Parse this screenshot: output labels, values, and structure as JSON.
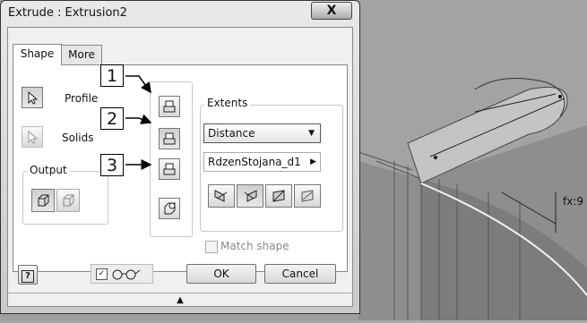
{
  "dialog": {
    "title": "Extrude : Extrusion2",
    "close_label": "X",
    "tabs": [
      {
        "label": "Shape"
      },
      {
        "label": "More"
      }
    ],
    "profile_label": "Profile",
    "solids_label": "Solids",
    "output_label": "Output",
    "extents_label": "Extents",
    "extents_value": "Distance",
    "distance_value": "RdzenStojana_d1",
    "match_shape_label": "Match shape",
    "ok_label": "OK",
    "cancel_label": "Cancel",
    "help_label": "?",
    "preview_checked": true
  },
  "callouts": [
    "1",
    "2",
    "3"
  ],
  "viewport": {
    "dimension_label": "fx:9"
  }
}
